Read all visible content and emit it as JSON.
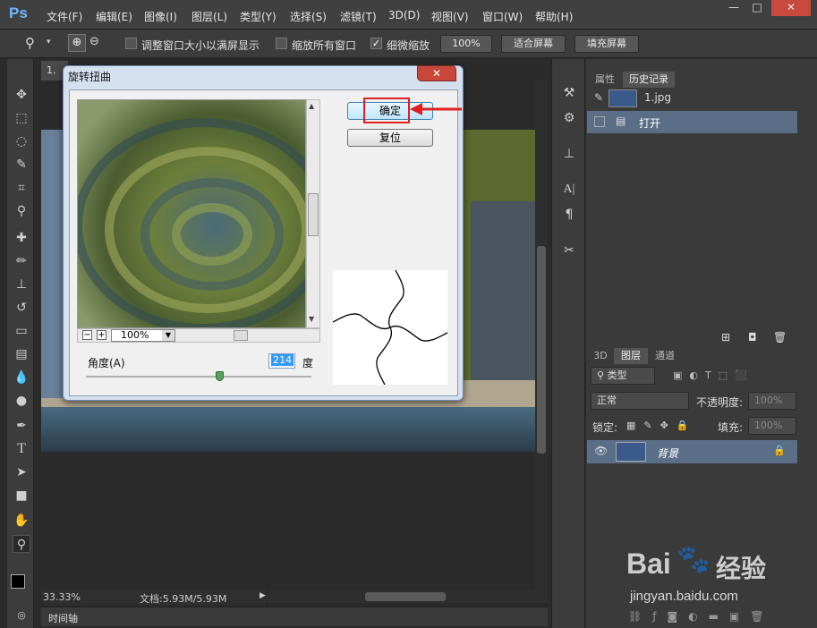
{
  "app": {
    "logo": "Ps"
  },
  "menu": [
    "文件(F)",
    "编辑(E)",
    "图像(I)",
    "图层(L)",
    "类型(Y)",
    "选择(S)",
    "滤镜(T)",
    "3D(D)",
    "视图(V)",
    "窗口(W)",
    "帮助(H)"
  ],
  "window_controls": {
    "minimize": "—",
    "restore": "□",
    "close": "✕"
  },
  "options": {
    "resize_windows": "调整窗口大小以满屏显示",
    "zoom_all": "缩放所有窗口",
    "scrubby_zoom": "细微缩放",
    "scrubby_checked": true,
    "zoom_100": "100%",
    "fit_screen": "适合屏幕",
    "fill_screen": "填充屏幕"
  },
  "document": {
    "tab": "1."
  },
  "status": {
    "zoom": "33.33%",
    "doc_size": "文档:5.93M/5.93M"
  },
  "timeline": {
    "label": "时间轴"
  },
  "history_panel": {
    "tabs": [
      "属性",
      "历史记录"
    ],
    "snapshot_name": "1.jpg",
    "items": [
      "打开"
    ]
  },
  "layers_panel": {
    "tabs": [
      "3D",
      "图层",
      "通道"
    ],
    "filter": "类型",
    "blend_mode": "正常",
    "opacity_label": "不透明度:",
    "opacity_value": "100%",
    "lock_label": "锁定:",
    "fill_label": "填充:",
    "fill_value": "100%",
    "layers": [
      {
        "name": "背景",
        "visible": true,
        "locked": true
      }
    ]
  },
  "dialog": {
    "title": "旋转扭曲",
    "ok_label": "确定",
    "reset_label": "复位",
    "preview_zoom": "100%",
    "angle_label": "角度(A)",
    "angle_value": "214",
    "angle_unit": "度",
    "angle_fraction": 0.594
  },
  "colors": {
    "accent_highlight": "#e02020",
    "ps_blue": "#6fb7ff"
  },
  "watermark": {
    "brand": "Bai",
    "brand2": "经验",
    "url": "jingyan.baidu.com"
  }
}
